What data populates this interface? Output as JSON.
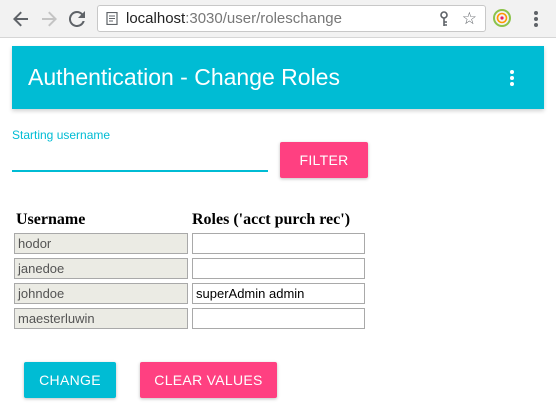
{
  "browser": {
    "url_host": "localhost",
    "url_rest": ":3030/user/roleschange",
    "icons": [
      "back-arrow-icon",
      "forward-arrow-icon",
      "reload-icon",
      "page-info-icon",
      "key-icon",
      "star-icon",
      "extension-icon",
      "chrome-menu-icon"
    ]
  },
  "app_bar": {
    "title": "Authentication - Change Roles",
    "color": "#00bcd4"
  },
  "filter": {
    "label": "Starting username",
    "value": "",
    "button_label": "FILTER",
    "button_color": "#ff4081"
  },
  "table": {
    "headers": [
      "Username",
      "Roles ('acct purch rec')"
    ],
    "rows": [
      {
        "username": "hodor",
        "roles": ""
      },
      {
        "username": "janedoe",
        "roles": ""
      },
      {
        "username": "johndoe",
        "roles": "superAdmin admin"
      },
      {
        "username": "maesterluwin",
        "roles": ""
      }
    ]
  },
  "actions": {
    "change_label": "CHANGE",
    "clear_label": "CLEAR VALUES"
  }
}
